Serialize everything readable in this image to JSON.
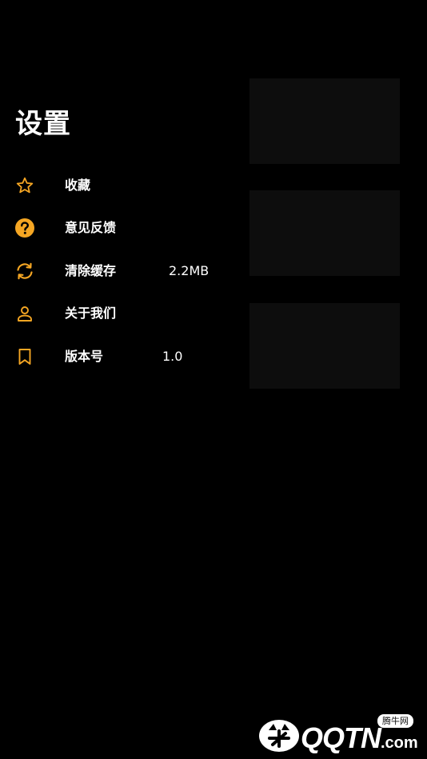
{
  "page": {
    "title": "设置"
  },
  "menu": {
    "items": [
      {
        "icon": "star-outline-icon",
        "label": "收藏",
        "value": ""
      },
      {
        "icon": "question-circle-icon",
        "label": "意见反馈",
        "value": ""
      },
      {
        "icon": "refresh-icon",
        "label": "清除缓存",
        "value": "2.2MB"
      },
      {
        "icon": "person-icon",
        "label": "关于我们",
        "value": ""
      },
      {
        "icon": "bookmark-icon",
        "label": "版本号",
        "value": "1.0"
      }
    ]
  },
  "watermark": {
    "brand": "QQTN",
    "suffix": ".com",
    "tag": "腾牛网"
  },
  "colors": {
    "background": "#000000",
    "accent": "#f5a623",
    "text": "#ffffff",
    "card": "#0d0d0d"
  }
}
